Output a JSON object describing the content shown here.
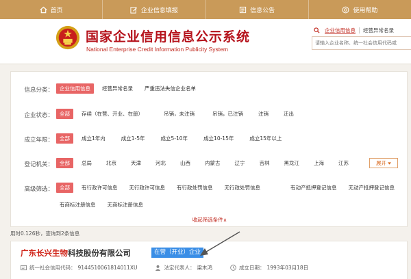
{
  "nav": {
    "items": [
      {
        "label": "首页",
        "icon": "home-icon"
      },
      {
        "label": "企业信息填报",
        "icon": "edit-icon"
      },
      {
        "label": "信息公告",
        "icon": "notice-icon"
      },
      {
        "label": "使用帮助",
        "icon": "help-icon"
      }
    ]
  },
  "header": {
    "title": "国家企业信用信息公示系统",
    "subtitle": "National Enterprise Credit Information Publicity System",
    "search_tabs": [
      "企业信用信息",
      "经营异常名录"
    ],
    "search_placeholder": "请输入企业名称、统一社会信用代码或"
  },
  "filters": {
    "info_category": {
      "label": "信息分类：",
      "options": [
        "企业信用信息",
        "经营异常名录",
        "严重违法失信企业名单"
      ],
      "active": 0
    },
    "status": {
      "label": "企业状态：",
      "options": [
        "全部",
        "存续（在营、开业、在册）",
        "吊销，未注销",
        "吊销，已注销",
        "注销",
        "迁出"
      ],
      "active": 0
    },
    "years": {
      "label": "成立年限：",
      "options": [
        "全部",
        "成立1年内",
        "成立1-5年",
        "成立5-10年",
        "成立10-15年",
        "成立15年以上"
      ],
      "active": 0
    },
    "authority": {
      "label": "登记机关：",
      "options": [
        "全部",
        "总局",
        "北京",
        "天津",
        "河北",
        "山西",
        "内蒙古",
        "辽宁",
        "吉林",
        "黑龙江",
        "上海",
        "江苏"
      ],
      "active": 0
    },
    "advanced": {
      "label": "高级筛选：",
      "options": [
        "全部",
        "有行政许可信息",
        "无行政许可信息",
        "有行政处罚信息",
        "无行政处罚信息",
        "有动产抵押登记信息",
        "无动产抵押登记信息",
        "有商标注册信息",
        "无商标注册信息"
      ],
      "active": 0
    },
    "expand_label": "展开",
    "collapse_label": "收起筛选条件∧"
  },
  "result_meta": "用时0.126秒，查询到2条信息",
  "result": {
    "name_highlight": "广东长兴生物",
    "name_rest": "科技股份有限公司",
    "status": "在营（开业）企业",
    "credit_code_label": "统一社会信用代码：",
    "credit_code": "9144510061814011XU",
    "legal_rep_label": "法定代表人：",
    "legal_rep": "梁木鸿",
    "founded_label": "成立日期：",
    "founded": "1993年03月18日"
  },
  "colors": {
    "nav_bg": "#c99a59",
    "title_red": "#b5121b",
    "filter_active": "#e86565",
    "badge_blue": "#3a8ee6"
  }
}
